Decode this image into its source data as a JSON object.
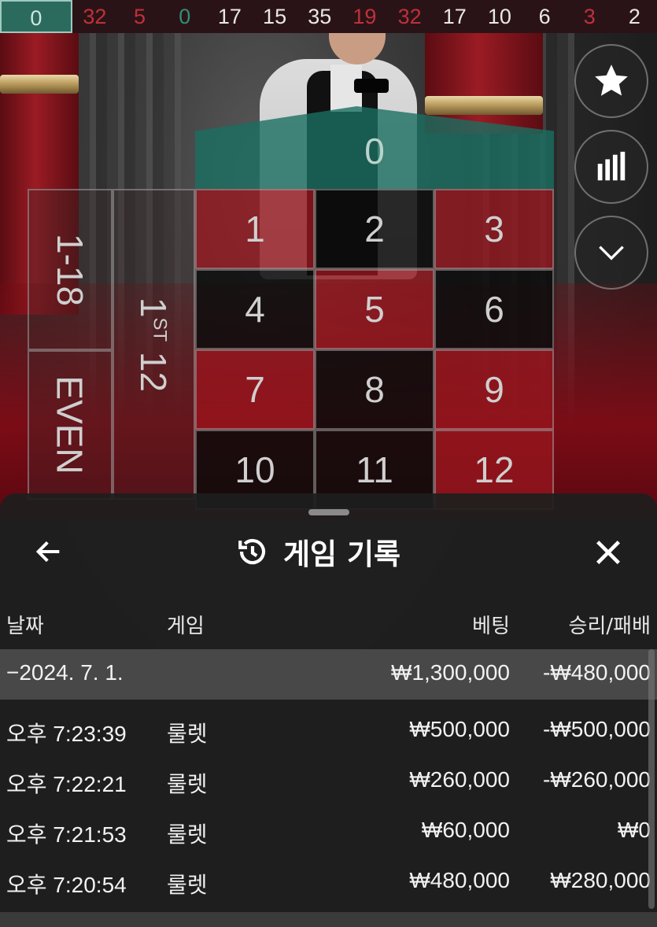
{
  "history": {
    "numbers": [
      {
        "value": "0",
        "color": "#2b6b5e"
      },
      {
        "value": "32",
        "color": "#c0303a"
      },
      {
        "value": "5",
        "color": "#c0303a"
      },
      {
        "value": "0",
        "color": "#2f8f7c"
      },
      {
        "value": "17",
        "color": "#e8e8e8"
      },
      {
        "value": "15",
        "color": "#e8e8e8"
      },
      {
        "value": "35",
        "color": "#e8e8e8"
      },
      {
        "value": "19",
        "color": "#c0303a"
      },
      {
        "value": "32",
        "color": "#c0303a"
      },
      {
        "value": "17",
        "color": "#e8e8e8"
      },
      {
        "value": "10",
        "color": "#e8e8e8"
      },
      {
        "value": "6",
        "color": "#e8e8e8"
      },
      {
        "value": "3",
        "color": "#c0303a"
      },
      {
        "value": "2",
        "color": "#e8e8e8"
      }
    ]
  },
  "board": {
    "zero": "0",
    "cells": [
      {
        "label": "1",
        "color": "red"
      },
      {
        "label": "2",
        "color": "black"
      },
      {
        "label": "3",
        "color": "red"
      },
      {
        "label": "4",
        "color": "black"
      },
      {
        "label": "5",
        "color": "red"
      },
      {
        "label": "6",
        "color": "black"
      },
      {
        "label": "7",
        "color": "red"
      },
      {
        "label": "8",
        "color": "black"
      },
      {
        "label": "9",
        "color": "red"
      },
      {
        "label": "10",
        "color": "black"
      },
      {
        "label": "11",
        "color": "black"
      },
      {
        "label": "12",
        "color": "red"
      }
    ],
    "low_bet": "1-18",
    "even_bet": "EVEN",
    "dozen_num": "1",
    "dozen_sup": "ST",
    "dozen_rest": " 12"
  },
  "side_buttons": {
    "favorite_icon": "star-icon",
    "stats_icon": "bar-chart-icon",
    "collapse_icon": "chevron-down-icon"
  },
  "sheet": {
    "title": "게임 기록",
    "title_icon": "history-icon",
    "back_icon": "arrow-left-icon",
    "close_icon": "close-icon",
    "columns": {
      "date": "날짜",
      "game": "게임",
      "bet": "베팅",
      "result": "승리/패배"
    },
    "summary": {
      "date": "−2024. 7. 1.",
      "bet": "₩1,300,000",
      "result": "-₩480,000"
    },
    "rows": [
      {
        "time": "오후 7:23:39",
        "game": "룰렛",
        "bet": "₩500,000",
        "result": "-₩500,000"
      },
      {
        "time": "오후 7:22:21",
        "game": "룰렛",
        "bet": "₩260,000",
        "result": "-₩260,000"
      },
      {
        "time": "오후 7:21:53",
        "game": "룰렛",
        "bet": "₩60,000",
        "result": "₩0"
      },
      {
        "time": "오후 7:20:54",
        "game": "룰렛",
        "bet": "₩480,000",
        "result": "₩280,000"
      }
    ]
  }
}
